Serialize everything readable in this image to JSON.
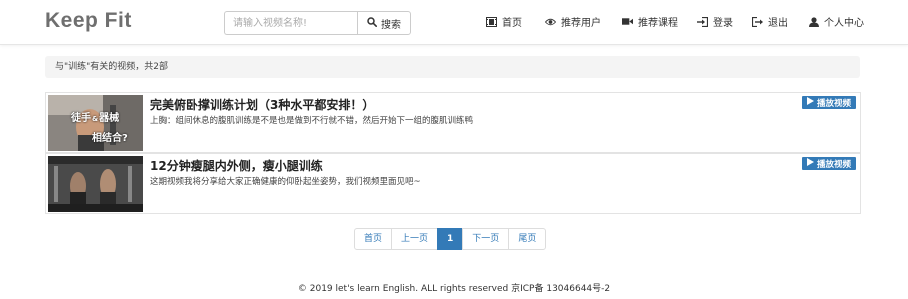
{
  "header": {
    "brand": "Keep Fit",
    "search": {
      "placeholder": "请输入视频名称!",
      "button_label": "搜索"
    },
    "nav": {
      "home": "首页",
      "users": "推荐用户",
      "courses": "推荐课程",
      "login": "登录",
      "logout": "退出",
      "profile": "个人中心"
    }
  },
  "summary": "与\"训练\"有关的视频，共2部",
  "videos": [
    {
      "title": "完美俯卧撑训练计划（3种水平都安排！）",
      "description": "上胸：组间休息的腹肌训练是不是也是做到不行就不错，然后开始下一组的腹肌训练鸭",
      "thumb_caption_1": "徒手",
      "thumb_caption_amp": "&",
      "thumb_caption_2": "器械",
      "thumb_caption_3": "相结合?",
      "play_label": "播放视频"
    },
    {
      "title": "12分钟瘦腿内外侧，瘦小腿训练",
      "description": "这期视频我将分享给大家正确健康的仰卧起坐姿势，我们视频里面见吧~",
      "play_label": "播放视频"
    }
  ],
  "pagination": {
    "first": "首页",
    "prev": "上一页",
    "current": "1",
    "next": "下一页",
    "last": "尾页"
  },
  "footer": "© 2019 let's learn English. ALL rights reserved 京ICP备 13046644号-2",
  "colors": {
    "accent": "#337ab7",
    "brand": "#6f6f6f",
    "summary_bg": "#f4f4f4"
  }
}
